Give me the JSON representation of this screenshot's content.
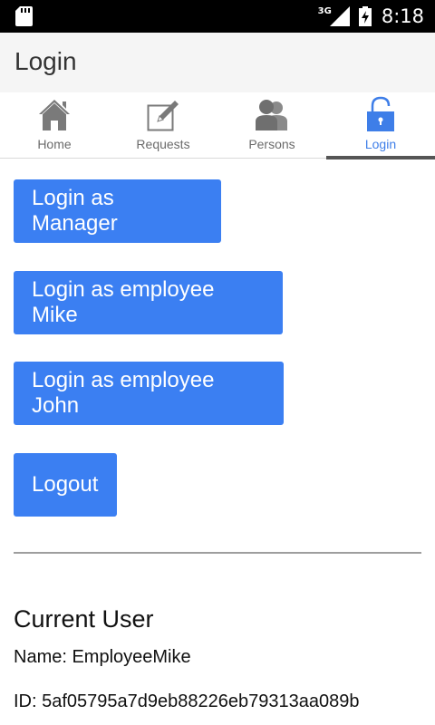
{
  "status_bar": {
    "time": "8:18",
    "network": "3G",
    "icons": [
      "sd-card-icon",
      "signal-icon",
      "battery-charging-icon"
    ]
  },
  "app_bar": {
    "title": "Login"
  },
  "tabs": [
    {
      "label": "Home",
      "icon": "home-icon",
      "active": false
    },
    {
      "label": "Requests",
      "icon": "edit-icon",
      "active": false
    },
    {
      "label": "Persons",
      "icon": "persons-icon",
      "active": false
    },
    {
      "label": "Login",
      "icon": "unlock-icon",
      "active": true
    }
  ],
  "buttons": {
    "manager": "Login as Manager",
    "mike": "Login as employee Mike",
    "john": "Login as employee John",
    "logout": "Logout"
  },
  "current_user": {
    "heading": "Current User",
    "name": "Name: EmployeeMike",
    "id": "ID: 5af05795a7d9eb88226eb79313aa089b"
  },
  "colors": {
    "accent": "#3b7ff2",
    "active_tab": "#3e7ee8",
    "inactive_icon": "#7a7a7a"
  }
}
